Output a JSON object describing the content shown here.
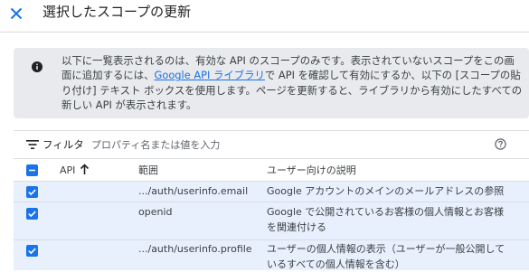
{
  "dialog": {
    "title": "選択したスコープの更新"
  },
  "info": {
    "text_before_link": "以下に一覧表示されるのは、有効な API のスコープのみです。表示されていないスコープをこの画面に追加するには、",
    "link_text": "Google API ライブラリ",
    "text_after_link": "で API を確認して有効にするか、以下の [スコープの貼り付け] テキスト ボックスを使用します。ページを更新すると、ライブラリから有効にしたすべての新しい API が表示されます。"
  },
  "filter": {
    "label": "フィルタ",
    "placeholder": "プロパティ名または値を入力"
  },
  "table": {
    "columns": {
      "api": "API",
      "scope": "範囲",
      "description": "ユーザー向けの説明"
    },
    "rows": [
      {
        "api": "",
        "scope": ".../auth/userinfo.email",
        "description": "Google アカウントのメインのメールアドレスの参照",
        "checked": true
      },
      {
        "api": "",
        "scope": "openid",
        "description": "Google で公開されているお客様の個人情報とお客様を関連付ける",
        "checked": true
      },
      {
        "api": "",
        "scope": ".../auth/userinfo.profile",
        "description": "ユーザーの個人情報の表示（ユーザーが一般公開しているすべての個人情報を含む）",
        "checked": true
      }
    ]
  },
  "colors": {
    "accent": "#1a73e8",
    "selected_row": "#e8f0fe",
    "info_background": "#e8eaed"
  },
  "icons": {
    "close": "close-icon",
    "info": "info-icon",
    "filter": "filter-icon",
    "help": "help-icon",
    "sort": "arrow-up-icon",
    "checkbox_checked": "checkbox-checked-icon",
    "checkbox_indeterminate": "checkbox-indeterminate-icon"
  }
}
